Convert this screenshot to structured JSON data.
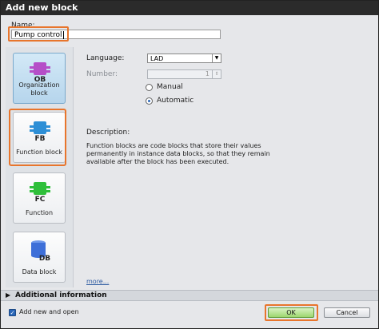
{
  "dialog": {
    "title": "Add new block",
    "name_label": "Name:",
    "name_value": "Pump control"
  },
  "block_types": [
    {
      "label_line1": "Organization",
      "label_line2": "block",
      "icon": "organization-block-icon",
      "badge": "OB",
      "selected": true
    },
    {
      "label_line1": "Function block",
      "label_line2": "",
      "icon": "function-block-icon",
      "badge": "FB",
      "selected": false
    },
    {
      "label_line1": "Function",
      "label_line2": "",
      "icon": "function-icon",
      "badge": "FC",
      "selected": false
    },
    {
      "label_line1": "Data block",
      "label_line2": "",
      "icon": "data-block-icon",
      "badge": "DB",
      "selected": false
    }
  ],
  "settings": {
    "language_label": "Language:",
    "language_value": "LAD",
    "number_label": "Number:",
    "number_value": "1",
    "radio_manual": "Manual",
    "radio_automatic": "Automatic",
    "selected_numbering": "Automatic"
  },
  "description": {
    "title": "Description:",
    "text": "Function blocks are code blocks that store their values permanently in instance data blocks, so that they remain available after the block has been executed.",
    "more_link": "more..."
  },
  "additional_information": {
    "label": "Additional information"
  },
  "footer": {
    "add_new_open_label": "Add new and open",
    "add_new_open_checked": true,
    "ok_label": "OK",
    "cancel_label": "Cancel"
  },
  "colors": {
    "highlight": "#e8752c",
    "ob_icon": "#b54ec8",
    "fb_icon": "#2d8fd6",
    "fc_icon": "#2fbf3a",
    "db_icon": "#3e6fd8",
    "ok_button": "#9dd66f"
  }
}
